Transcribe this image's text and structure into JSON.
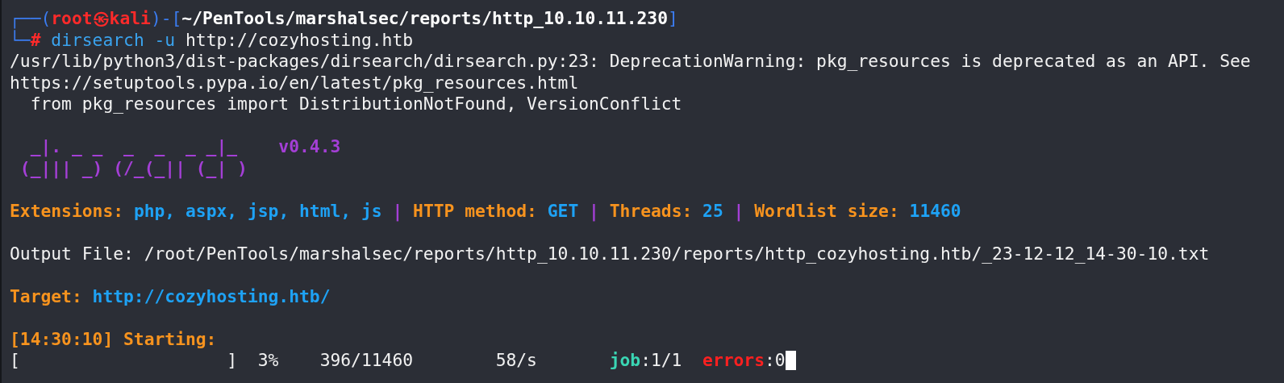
{
  "terminal": {
    "blocks": [
      {
        "lines": [
          {
            "segments": [
              {
                "kind": "frame",
                "text": "┌──("
              },
              {
                "kind": "user",
                "text": "root㉿kali"
              },
              {
                "kind": "frame",
                "text": ")-["
              },
              {
                "kind": "path",
                "text": "~/PenTools/marshalsec/reports/http_10.10.11.230"
              },
              {
                "kind": "frame",
                "text": "]"
              }
            ]
          },
          {
            "segments": [
              {
                "kind": "frame",
                "text": "└─"
              },
              {
                "kind": "user",
                "text": "#"
              },
              {
                "kind": "command",
                "text": " dirsearch -u"
              },
              {
                "kind": "plain",
                "text": " http://cozyhosting.htb"
              }
            ]
          },
          {
            "segments": [
              {
                "kind": "plain",
                "text": "/usr/lib/python3/dist-packages/dirsearch/dirsearch.py:23: DeprecationWarning: pkg_resources is deprecated as an API. See"
              }
            ]
          },
          {
            "segments": [
              {
                "kind": "plain",
                "text": "https://setuptools.pypa.io/en/latest/pkg_resources.html"
              }
            ]
          },
          {
            "segments": [
              {
                "kind": "plain",
                "text": "  from pkg_resources import DistributionNotFound, VersionConflict"
              }
            ]
          }
        ]
      },
      {
        "lines": [
          {
            "segments": [
              {
                "kind": "banner",
                "text": "  _|. _ _  _  _  _ _|_    v0.4.3"
              }
            ]
          },
          {
            "segments": [
              {
                "kind": "banner",
                "text": " (_||| _) (/_(_|| (_| )"
              }
            ]
          }
        ]
      },
      {
        "lines": [
          {
            "segments": [
              {
                "kind": "label",
                "text": "Extensions: "
              },
              {
                "kind": "value",
                "text": "php, aspx, jsp, html, js"
              },
              {
                "kind": "separator",
                "text": " | "
              },
              {
                "kind": "label",
                "text": "HTTP method: "
              },
              {
                "kind": "value",
                "text": "GET"
              },
              {
                "kind": "separator",
                "text": " | "
              },
              {
                "kind": "label",
                "text": "Threads: "
              },
              {
                "kind": "value",
                "text": "25"
              },
              {
                "kind": "separator",
                "text": " | "
              },
              {
                "kind": "label",
                "text": "Wordlist size: "
              },
              {
                "kind": "value",
                "text": "11460"
              }
            ]
          }
        ]
      },
      {
        "lines": [
          {
            "segments": [
              {
                "kind": "plain",
                "text": "Output File: /root/PenTools/marshalsec/reports/http_10.10.11.230/reports/http_cozyhosting.htb/_23-12-12_14-30-10.txt"
              }
            ]
          }
        ]
      },
      {
        "lines": [
          {
            "segments": [
              {
                "kind": "label",
                "text": "Target: "
              },
              {
                "kind": "value",
                "text": "http://cozyhosting.htb/"
              }
            ]
          }
        ]
      },
      {
        "lines": [
          {
            "segments": [
              {
                "kind": "label",
                "text": "[14:30:10] Starting:"
              }
            ]
          },
          {
            "segments": [
              {
                "kind": "plain",
                "text": "[                    ]  3%    396/11460        58/s       "
              },
              {
                "kind": "job",
                "text": "job"
              },
              {
                "kind": "plain",
                "text": ":1/1  "
              },
              {
                "kind": "error",
                "text": "errors"
              },
              {
                "kind": "plain",
                "text": ":0"
              }
            ],
            "cursor": true
          }
        ]
      }
    ]
  }
}
